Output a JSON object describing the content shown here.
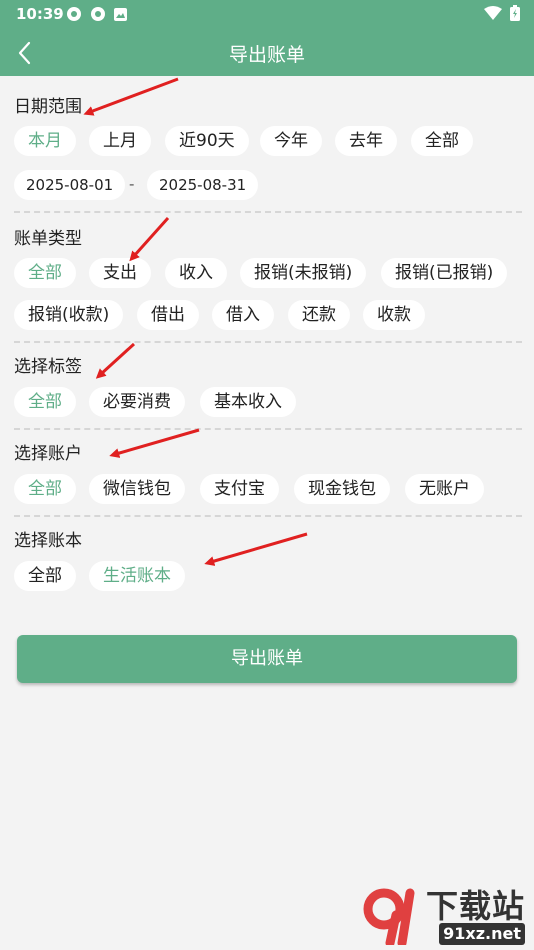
{
  "status": {
    "time": "10:39"
  },
  "appbar": {
    "title": "导出账单"
  },
  "sections": {
    "date": {
      "label": "日期范围",
      "chips": [
        "本月",
        "上月",
        "近90天",
        "今年",
        "去年",
        "全部"
      ],
      "start": "2025-08-01",
      "separator": "-",
      "end": "2025-08-31",
      "selected": "本月"
    },
    "type": {
      "label": "账单类型",
      "chips": [
        "全部",
        "支出",
        "收入",
        "报销(未报销)",
        "报销(已报销)",
        "报销(收款)",
        "借出",
        "借入",
        "还款",
        "收款"
      ],
      "selected": "全部"
    },
    "tag": {
      "label": "选择标签",
      "chips": [
        "全部",
        "必要消费",
        "基本收入"
      ],
      "selected": "全部"
    },
    "account": {
      "label": "选择账户",
      "chips": [
        "全部",
        "微信钱包",
        "支付宝",
        "现金钱包",
        "无账户"
      ],
      "selected": "全部"
    },
    "book": {
      "label": "选择账本",
      "chips": [
        "全部",
        "生活账本"
      ],
      "selected": "生活账本"
    }
  },
  "export_button": "导出账单",
  "watermark": {
    "brand": "下载站",
    "url": "91xz.net"
  },
  "colors": {
    "accent": "#5fae88",
    "arrow": "#e02020"
  }
}
